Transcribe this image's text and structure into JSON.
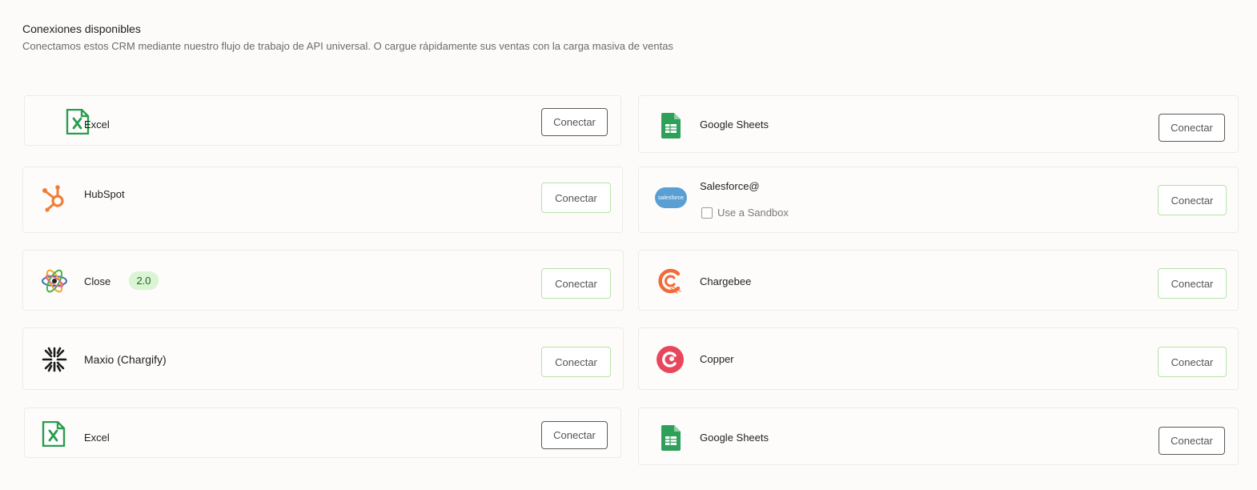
{
  "header": {
    "title": "Conexiones disponibles",
    "subtitle": "Conectamos estos CRM mediante nuestro flujo de trabajo de API universal. O cargue rápidamente sus ventas con la carga masiva de ventas"
  },
  "connect_label": "Conectar",
  "colors": {
    "excel": "#2a9d4e",
    "sheets": "#2fa05a",
    "hubspot": "#f07d3a",
    "salesforce": "#5a9fd4",
    "chargebee": "#f06a3a",
    "copper": "#e8465c",
    "badge_bg": "#d9f5d3"
  },
  "left": [
    {
      "name": "Excel",
      "icon": "excel-icon"
    },
    {
      "name": "HubSpot",
      "icon": "hubspot-icon"
    },
    {
      "name": "Close",
      "icon": "close-icon",
      "badge": "2.0"
    },
    {
      "name": "Maxio (Chargify)",
      "icon": "maxio-icon"
    },
    {
      "name": "Excel",
      "icon": "excel-icon"
    }
  ],
  "right": [
    {
      "name": "Google Sheets",
      "icon": "google-sheets-icon"
    },
    {
      "name": "Salesforce@",
      "icon": "salesforce-icon",
      "logo_text": "salesforce",
      "sandbox_label": "Use a Sandbox"
    },
    {
      "name": "Chargebee",
      "icon": "chargebee-icon"
    },
    {
      "name": "Copper",
      "icon": "copper-icon"
    },
    {
      "name": "Google Sheets",
      "icon": "google-sheets-icon"
    }
  ]
}
